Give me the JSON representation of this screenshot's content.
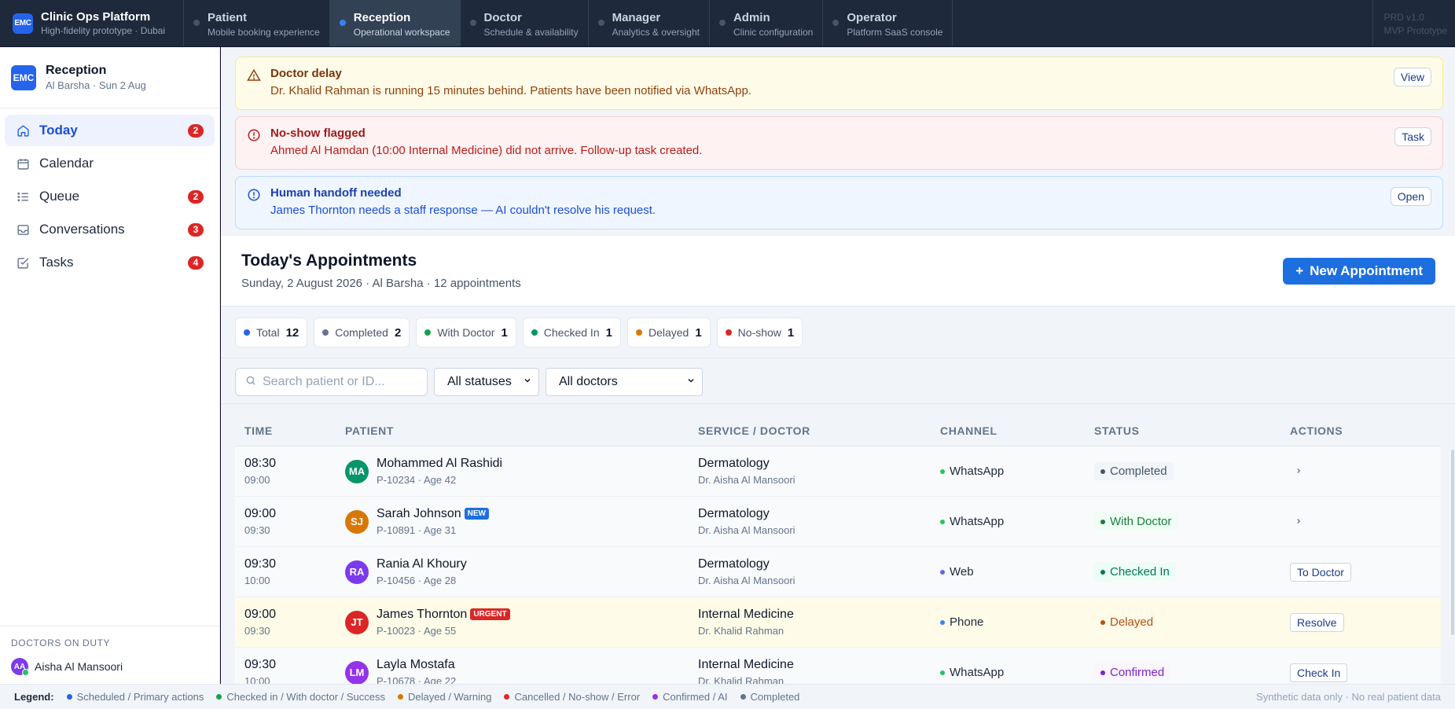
{
  "app": {
    "logo_text": "EMC",
    "title": "Clinic Ops Platform",
    "subtitle": "High-fidelity prototype · Dubai",
    "prd_line1": "PRD v1.0",
    "prd_line2": "MVP Prototype"
  },
  "roles": [
    {
      "name": "Patient",
      "sub": "Mobile booking experience",
      "active": false
    },
    {
      "name": "Reception",
      "sub": "Operational workspace",
      "active": true
    },
    {
      "name": "Doctor",
      "sub": "Schedule & availability",
      "active": false
    },
    {
      "name": "Manager",
      "sub": "Analytics & oversight",
      "active": false
    },
    {
      "name": "Admin",
      "sub": "Clinic configuration",
      "active": false
    },
    {
      "name": "Operator",
      "sub": "Platform SaaS console",
      "active": false
    }
  ],
  "sidebar": {
    "logo_text": "EMC",
    "title": "Reception",
    "subtitle": "Al Barsha · Sun 2 Aug",
    "items": [
      {
        "label": "Today",
        "badge": "2",
        "icon": "home-icon",
        "active": true
      },
      {
        "label": "Calendar",
        "badge": "",
        "icon": "calendar-icon",
        "active": false
      },
      {
        "label": "Queue",
        "badge": "2",
        "icon": "list-icon",
        "active": false
      },
      {
        "label": "Conversations",
        "badge": "3",
        "icon": "inbox-icon",
        "active": false
      },
      {
        "label": "Tasks",
        "badge": "4",
        "icon": "checkbox-icon",
        "active": false
      }
    ],
    "duty_heading": "Doctors on duty",
    "duty_doctor": {
      "initials": "AA",
      "name": "Aisha Al Mansoori"
    }
  },
  "alerts": [
    {
      "type": "warn",
      "icon": "warning-triangle-icon",
      "title": "Doctor delay",
      "text": "Dr. Khalid Rahman is running 15 minutes behind. Patients have been notified via WhatsApp.",
      "action": "View"
    },
    {
      "type": "err",
      "icon": "alert-circle-icon",
      "title": "No-show flagged",
      "text": "Ahmed Al Hamdan (10:00 Internal Medicine) did not arrive. Follow-up task created.",
      "action": "Task"
    },
    {
      "type": "info",
      "icon": "info-circle-icon",
      "title": "Human handoff needed",
      "text": "James Thornton needs a staff response — AI couldn't resolve his request.",
      "action": "Open"
    }
  ],
  "page": {
    "title": "Today's Appointments",
    "subtitle": "Sunday, 2 August 2026 · Al Barsha · 12 appointments",
    "new_button": "New Appointment"
  },
  "stats": [
    {
      "label": "Total",
      "value": "12",
      "color": "#2563eb"
    },
    {
      "label": "Completed",
      "value": "2",
      "color": "#64748b"
    },
    {
      "label": "With Doctor",
      "value": "1",
      "color": "#16a34a"
    },
    {
      "label": "Checked In",
      "value": "1",
      "color": "#059669"
    },
    {
      "label": "Delayed",
      "value": "1",
      "color": "#d97706"
    },
    {
      "label": "No-show",
      "value": "1",
      "color": "#dc2626"
    }
  ],
  "filters": {
    "search_placeholder": "Search patient or ID...",
    "status_select": "All statuses",
    "doctor_select": "All doctors"
  },
  "table": {
    "headers": [
      "Time",
      "Patient",
      "Service / Doctor",
      "Channel",
      "Status",
      "Actions"
    ],
    "rows": [
      {
        "time": "08:30",
        "end": "09:00",
        "initials": "MA",
        "avatar_color": "#059669",
        "name": "Mohammed Al Rashidi",
        "tag": "",
        "meta": "P-10234 · Age 42",
        "service": "Dermatology",
        "doctor": "Dr. Aisha Al Mansoori",
        "channel": "WhatsApp",
        "channel_color": "#22c55e",
        "status": "Completed",
        "status_color": "#475569",
        "status_bg": "#f1f5f9",
        "action": "",
        "highlight": false
      },
      {
        "time": "09:00",
        "end": "09:30",
        "initials": "SJ",
        "avatar_color": "#d97706",
        "name": "Sarah Johnson",
        "tag": "NEW",
        "meta": "P-10891 · Age 31",
        "service": "Dermatology",
        "doctor": "Dr. Aisha Al Mansoori",
        "channel": "WhatsApp",
        "channel_color": "#22c55e",
        "status": "With Doctor",
        "status_color": "#15803d",
        "status_bg": "#f0fdf4",
        "action": "",
        "highlight": false
      },
      {
        "time": "09:30",
        "end": "10:00",
        "initials": "RA",
        "avatar_color": "#7c3aed",
        "name": "Rania Al Khoury",
        "tag": "",
        "meta": "P-10456 · Age 28",
        "service": "Dermatology",
        "doctor": "Dr. Aisha Al Mansoori",
        "channel": "Web",
        "channel_color": "#6366f1",
        "status": "Checked In",
        "status_color": "#047857",
        "status_bg": "#ecfdf5",
        "action": "To Doctor",
        "highlight": false
      },
      {
        "time": "09:00",
        "end": "09:30",
        "initials": "JT",
        "avatar_color": "#dc2626",
        "name": "James Thornton",
        "tag": "URGENT",
        "meta": "P-10023 · Age 55",
        "service": "Internal Medicine",
        "doctor": "Dr. Khalid Rahman",
        "channel": "Phone",
        "channel_color": "#3b82f6",
        "status": "Delayed",
        "status_color": "#b45309",
        "status_bg": "#fffbeb",
        "action": "Resolve",
        "highlight": true
      },
      {
        "time": "09:30",
        "end": "10:00",
        "initials": "LM",
        "avatar_color": "#9333ea",
        "name": "Layla Mostafa",
        "tag": "",
        "meta": "P-10678 · Age 22",
        "service": "Internal Medicine",
        "doctor": "Dr. Khalid Rahman",
        "channel": "WhatsApp",
        "channel_color": "#22c55e",
        "status": "Confirmed",
        "status_color": "#7e22ce",
        "status_bg": "#faf5ff",
        "action": "Check In",
        "highlight": false
      }
    ]
  },
  "legend": {
    "heading": "Legend:",
    "items": [
      {
        "label": "Scheduled / Primary actions",
        "color": "#2563eb"
      },
      {
        "label": "Checked in / With doctor / Success",
        "color": "#16a34a"
      },
      {
        "label": "Delayed / Warning",
        "color": "#d97706"
      },
      {
        "label": "Cancelled / No-show / Error",
        "color": "#dc2626"
      },
      {
        "label": "Confirmed / AI",
        "color": "#9333ea"
      },
      {
        "label": "Completed",
        "color": "#64748b"
      }
    ],
    "note": "Synthetic data only · No real patient data"
  }
}
